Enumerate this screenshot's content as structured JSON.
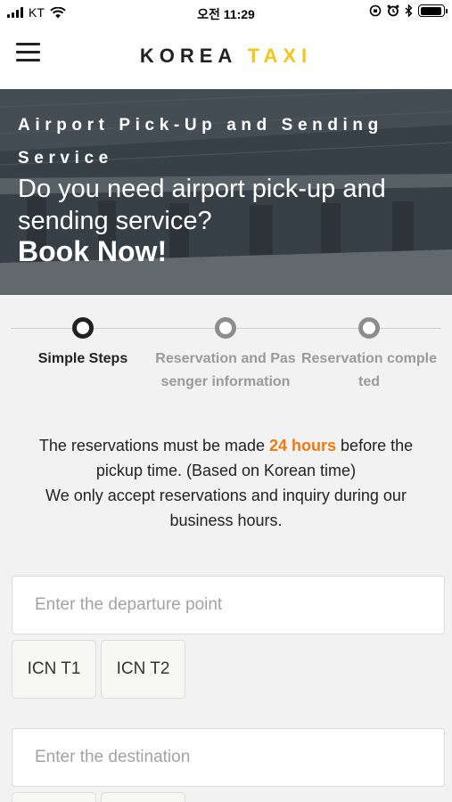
{
  "status_bar": {
    "carrier": "KT",
    "time": "오전 11:29"
  },
  "header": {
    "logo_part1": "KOREA",
    "logo_part2": "TAXI",
    "accent_color": "#f5c518"
  },
  "hero": {
    "subtitle": "Airport Pick-Up and Sending Service",
    "question": "Do you need airport pick-up and sending service?",
    "cta": "Book Now!"
  },
  "steps": [
    {
      "label": "Simple Steps",
      "active": true
    },
    {
      "label": "Reservation and Pas senger information",
      "active": false
    },
    {
      "label": "Reservation comple ted",
      "active": false
    }
  ],
  "notice": {
    "before": "The reservations must be made ",
    "highlight": "24 hours",
    "after": " before the pickup time. (Based on Korean time)",
    "line2": "We only accept reservations and inquiry during our business hours.",
    "highlight_color": "#f07a10"
  },
  "departure": {
    "placeholder": "Enter the departure point",
    "options": [
      "ICN T1",
      "ICN T2"
    ]
  },
  "destination": {
    "placeholder": "Enter the destination"
  }
}
